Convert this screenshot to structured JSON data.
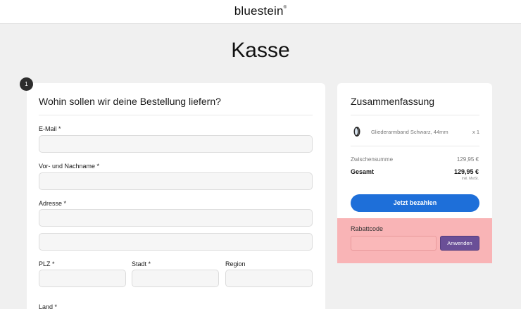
{
  "header": {
    "logo_text": "bluestein",
    "logo_mark": "®"
  },
  "page": {
    "title": "Kasse"
  },
  "delivery": {
    "step_number": "1",
    "heading": "Wohin sollen wir deine Bestellung liefern?",
    "fields": {
      "email_label": "E-Mail *",
      "name_label": "Vor- und Nachname *",
      "address_label": "Adresse *",
      "zip_label": "PLZ *",
      "city_label": "Stadt *",
      "region_label": "Region",
      "country_label": "Land *"
    }
  },
  "summary": {
    "heading": "Zusammenfassung",
    "product": {
      "name": "Gliederarmband Schwarz, 44mm",
      "qty": "x 1",
      "thumb_icon": "watch-band-icon"
    },
    "subtotal_label": "Zwischensumme",
    "subtotal_value": "129,95 €",
    "total_label": "Gesamt",
    "total_value": "129,95 €",
    "tax_note": "inkl. MwSt.",
    "pay_button": "Jetzt bezahlen"
  },
  "coupon": {
    "label": "Rabattcode",
    "input_value": "",
    "button": "Anwenden"
  },
  "colors": {
    "page_bg": "#f0f0f0",
    "card_bg": "#ffffff",
    "pay_button": "#1e6fd9",
    "coupon_highlight": "#f9b4b6",
    "coupon_button": "#6a4f97"
  }
}
